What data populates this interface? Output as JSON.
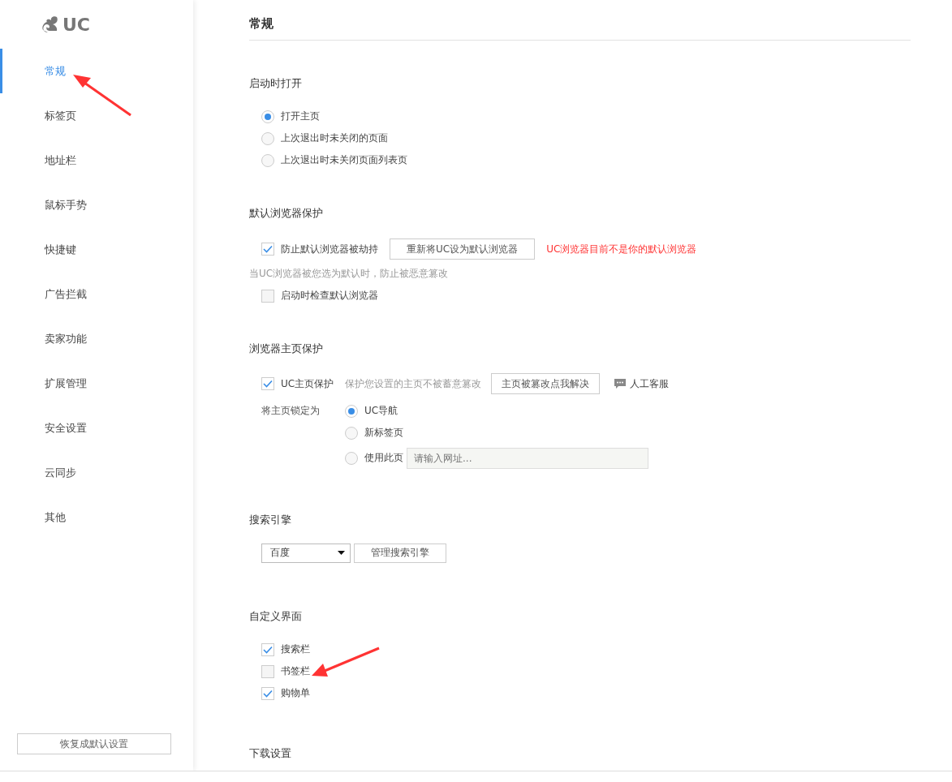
{
  "logo": {
    "text": "UC"
  },
  "sidebar": {
    "items": [
      {
        "label": "常规",
        "selected": true
      },
      {
        "label": "标签页",
        "selected": false
      },
      {
        "label": "地址栏",
        "selected": false
      },
      {
        "label": "鼠标手势",
        "selected": false
      },
      {
        "label": "快捷键",
        "selected": false
      },
      {
        "label": "广告拦截",
        "selected": false
      },
      {
        "label": "卖家功能",
        "selected": false
      },
      {
        "label": "扩展管理",
        "selected": false
      },
      {
        "label": "安全设置",
        "selected": false
      },
      {
        "label": "云同步",
        "selected": false
      },
      {
        "label": "其他",
        "selected": false
      }
    ],
    "reset_button": "恢复成默认设置"
  },
  "page_title": "常规",
  "startup": {
    "heading": "启动时打开",
    "options": [
      {
        "label": "打开主页",
        "selected": true
      },
      {
        "label": "上次退出时未关闭的页面",
        "selected": false
      },
      {
        "label": "上次退出时未关闭页面列表页",
        "selected": false
      }
    ]
  },
  "default_browser": {
    "heading": "默认浏览器保护",
    "protect": {
      "label": "防止默认浏览器被劫持",
      "checked": true
    },
    "button": "重新将UC设为默认浏览器",
    "warning": "UC浏览器目前不是你的默认浏览器",
    "hint": "当UC浏览器被您选为默认时，防止被恶意篡改",
    "check_on_start": {
      "label": "启动时检查默认浏览器",
      "checked": false
    }
  },
  "homepage": {
    "heading": "浏览器主页保护",
    "protect": {
      "label": "UC主页保护",
      "checked": true
    },
    "hint": "保护您设置的主页不被蓄意篡改",
    "fix_button": "主页被篡改点我解决",
    "support_link": "人工客服",
    "lock_label": "将主页锁定为",
    "lock_options": [
      {
        "label": "UC导航",
        "selected": true
      },
      {
        "label": "新标签页",
        "selected": false
      },
      {
        "label": "使用此页",
        "selected": false,
        "placeholder": "请输入网址..."
      }
    ]
  },
  "search_engine": {
    "heading": "搜索引擎",
    "value": "百度",
    "manage_button": "管理搜索引擎"
  },
  "custom_ui": {
    "heading": "自定义界面",
    "options": [
      {
        "label": "搜索栏",
        "checked": true
      },
      {
        "label": "书签栏",
        "checked": false
      },
      {
        "label": "购物单",
        "checked": true
      }
    ]
  },
  "download": {
    "heading": "下载设置"
  }
}
